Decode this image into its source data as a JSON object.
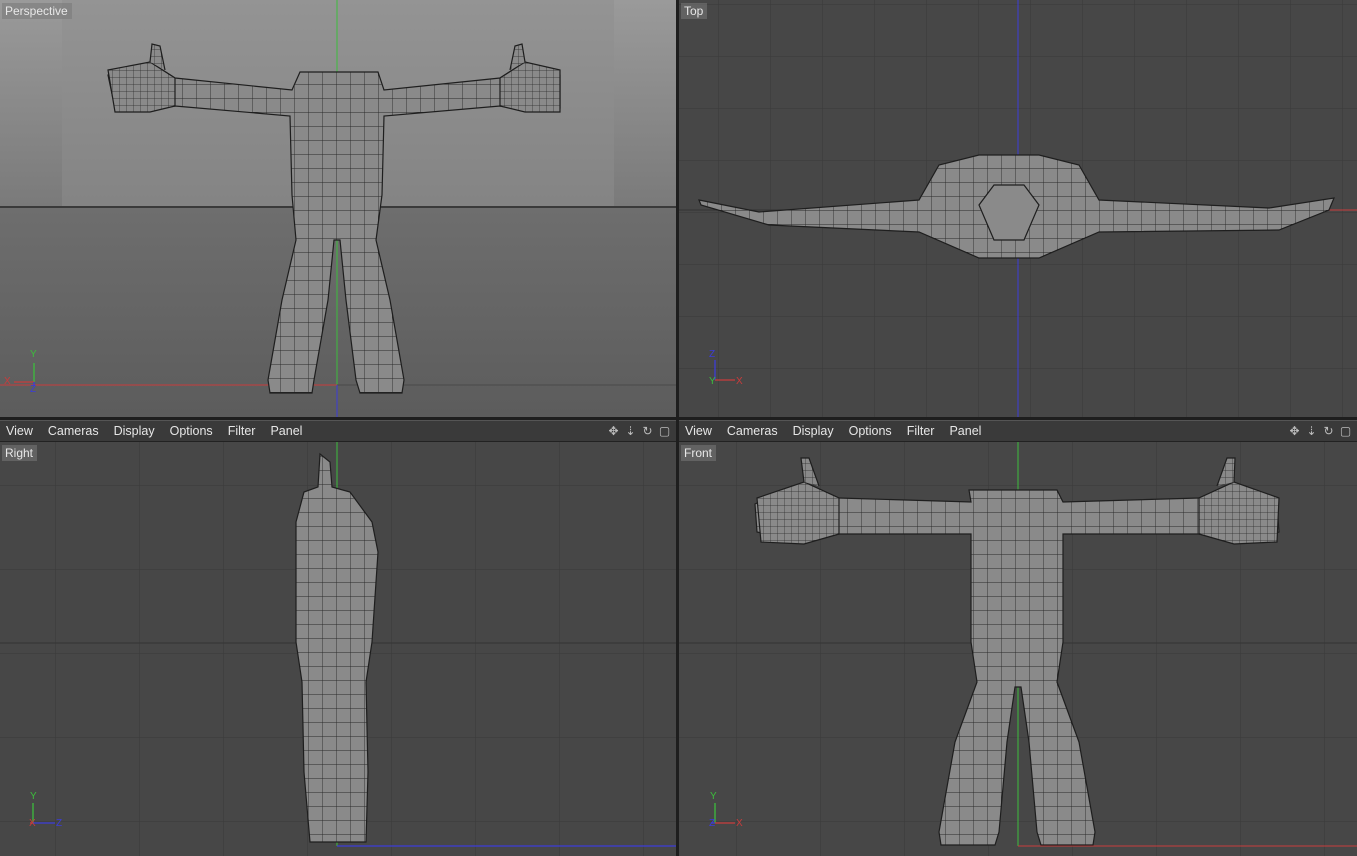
{
  "viewports": {
    "perspective": {
      "label": "Perspective"
    },
    "top": {
      "label": "Top"
    },
    "right": {
      "label": "Right"
    },
    "front": {
      "label": "Front"
    }
  },
  "menu": {
    "view": "View",
    "cameras": "Cameras",
    "display": "Display",
    "options": "Options",
    "filter": "Filter",
    "panel": "Panel"
  },
  "axes": {
    "x": "X",
    "y": "Y",
    "z": "Z"
  },
  "icons": [
    "move-icon",
    "zoom-icon",
    "rotate-icon",
    "maximize-icon"
  ],
  "colors": {
    "axis_x": "#c83c3c",
    "axis_y": "#3cbd3c",
    "axis_z": "#3c3cd8",
    "viewport_bg": "#474747",
    "mesh": "#8c8c8c"
  }
}
